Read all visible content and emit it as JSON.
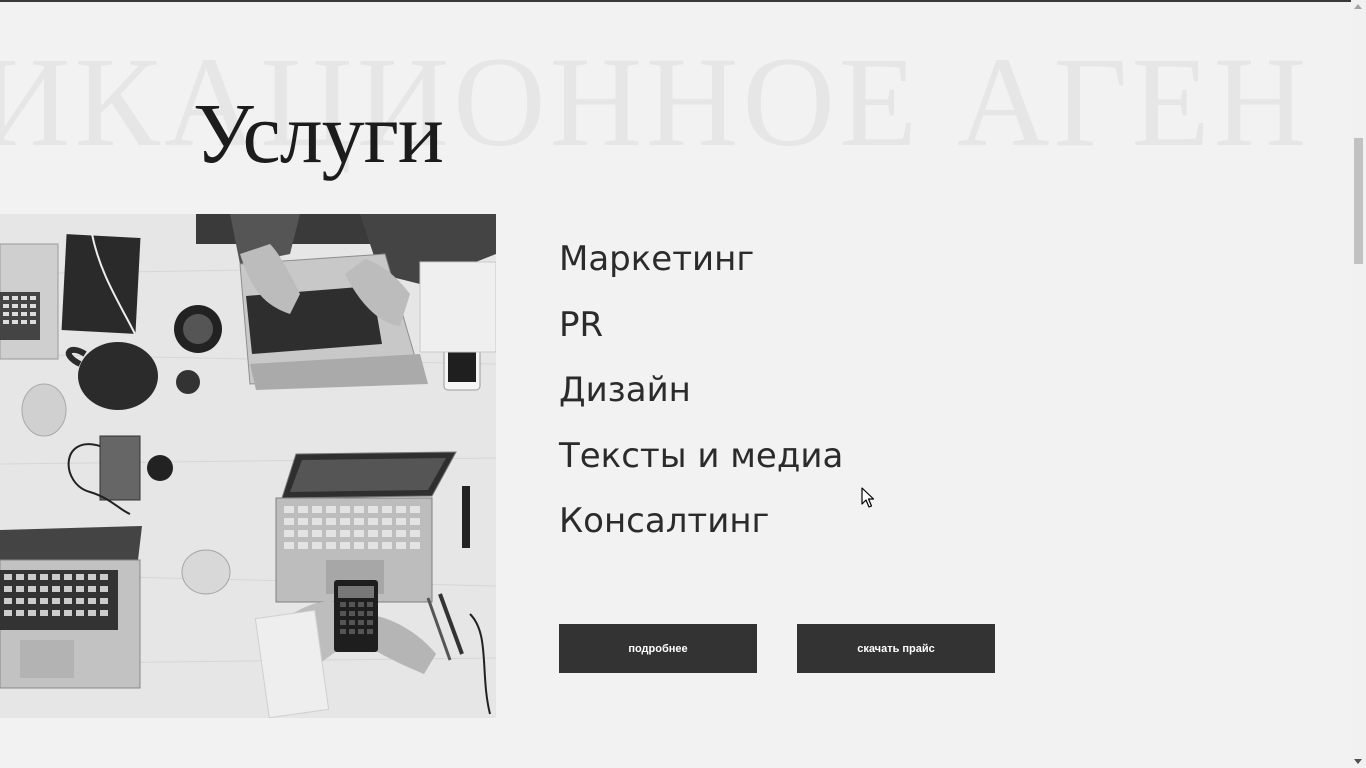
{
  "background_watermark": "ИКАЦИОННОЕ АГЕН",
  "section_title": "Услуги",
  "services": [
    "Маркетинг",
    "PR",
    "Дизайн",
    "Тексты и медиа",
    "Консалтинг"
  ],
  "buttons": {
    "more_label": "подробнее",
    "price_label": "скачать прайс"
  },
  "photo": {
    "alt": "office desk with laptops",
    "style": "grayscale"
  },
  "colors": {
    "background": "#f2f2f2",
    "button_bg": "#333333",
    "button_text": "#ffffff",
    "title_text": "#1c1c1c",
    "watermark_text": "#e6e6e6"
  },
  "icons": {
    "cursor": "arrow-pointer-icon",
    "scroll_up": "scroll-up-arrow-icon",
    "scroll_down": "scroll-down-arrow-icon"
  }
}
